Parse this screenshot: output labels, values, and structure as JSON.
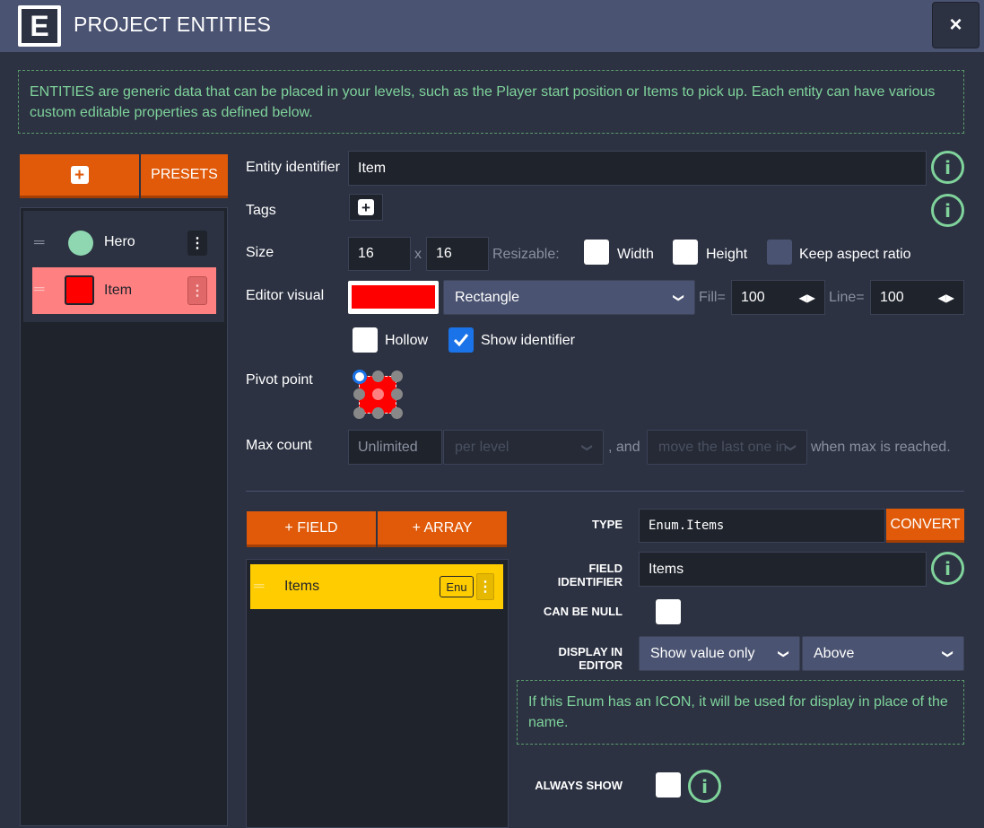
{
  "header": {
    "logo_letter": "E",
    "title": "PROJECT ENTITIES",
    "close_label": "×"
  },
  "help_text": "ENTITIES are generic data that can be placed in your levels, such as the Player start position or Items to pick up. Each entity can have various custom editable properties as defined below.",
  "sidebar": {
    "add_label": "+",
    "presets_label": "PRESETS",
    "entities": [
      {
        "name": "Hero",
        "color": "#8ed7b0",
        "selected": false
      },
      {
        "name": "Item",
        "color": "#ff0000",
        "selected": true
      }
    ]
  },
  "form": {
    "identifier_label": "Entity identifier",
    "identifier_value": "Item",
    "tags_label": "Tags",
    "size_label": "Size",
    "size_w": "16",
    "size_x": "x",
    "size_h": "16",
    "resizable_label": "Resizable:",
    "width_label": "Width",
    "height_label": "Height",
    "keep_aspect_label": "Keep aspect ratio",
    "editor_visual_label": "Editor visual",
    "visual_color": "#ff0000",
    "render_mode": "Rectangle",
    "fill_label": "Fill=",
    "fill_value": "100",
    "line_label": "Line=",
    "line_value": "100",
    "hollow_label": "Hollow",
    "show_identifier_label": "Show identifier",
    "pivot_label": "Pivot point",
    "max_count_label": "Max count",
    "max_count_placeholder": "Unlimited",
    "per_level": "per level",
    "and_label": ", and",
    "move_last": "move the last one in",
    "when_max": "when max is reached."
  },
  "fields": {
    "add_field_label": "+ FIELD",
    "add_array_label": "+ ARRAY",
    "items": [
      {
        "name": "Items",
        "badge": "Enu"
      }
    ]
  },
  "field_detail": {
    "type_label": "TYPE",
    "type_value": "Enum.Items",
    "convert_label": "CONVERT",
    "field_identifier_label_1": "FIELD",
    "field_identifier_label_2": "IDENTIFIER",
    "field_identifier_value": "Items",
    "can_be_null_label": "CAN BE NULL",
    "display_label_1": "DISPLAY IN",
    "display_label_2": "EDITOR",
    "display_mode": "Show value only",
    "display_position": "Above",
    "enum_help": "If this Enum has an ICON, it will be used for display in place of the name.",
    "always_show_label": "ALWAYS SHOW"
  },
  "icons": {
    "info": "i",
    "chevron": "⌄",
    "drag": "═",
    "menu": "⋮",
    "check": "✓"
  }
}
